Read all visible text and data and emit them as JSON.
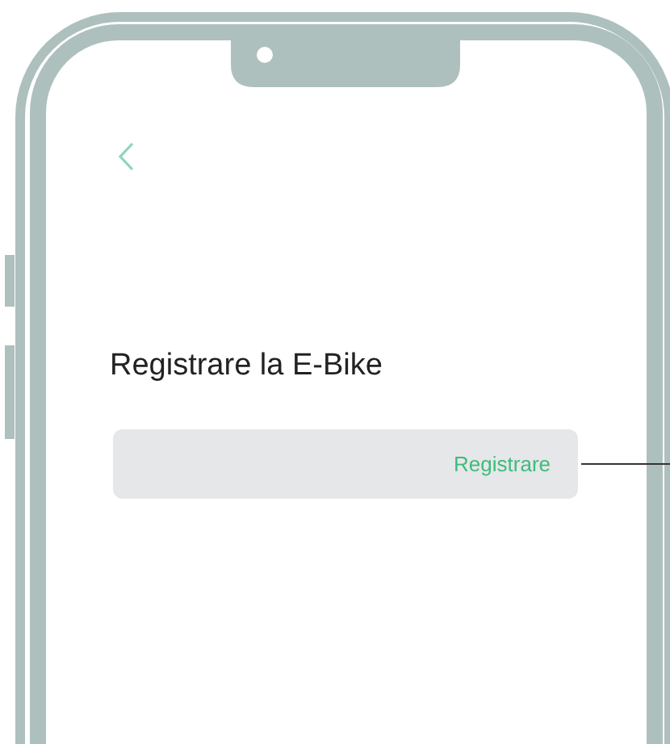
{
  "screen": {
    "title": "Registrare la E-Bike",
    "row": {
      "label": "Registrare"
    }
  }
}
